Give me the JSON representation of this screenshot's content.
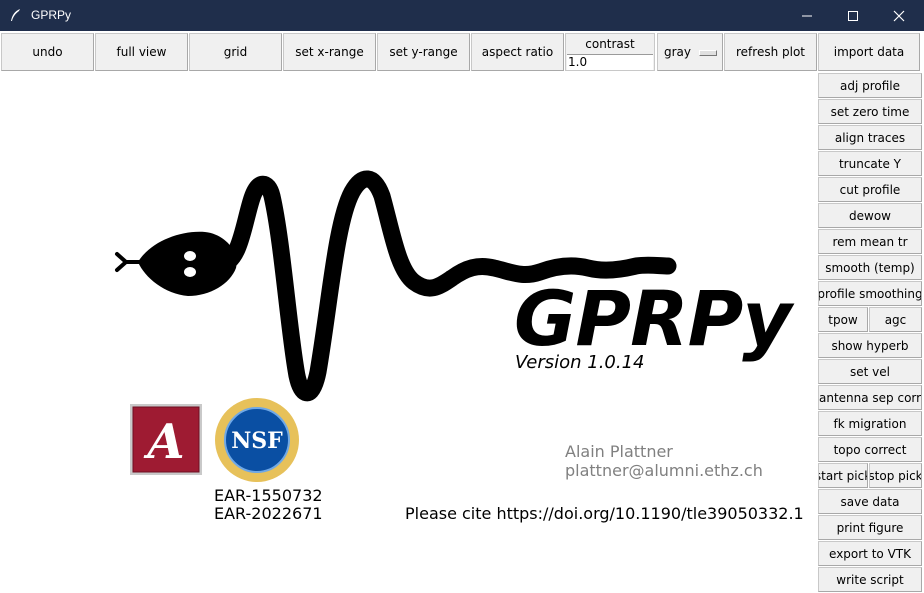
{
  "window": {
    "title": "GPRPy",
    "icon": "feather-icon",
    "controls": [
      "minimize-icon",
      "maximize-icon",
      "close-icon"
    ]
  },
  "toolbar": {
    "undo": "undo",
    "full_view": "full view",
    "grid": "grid",
    "set_x_range": "set x-range",
    "set_y_range": "set y-range",
    "aspect_ratio": "aspect ratio",
    "contrast_label": "contrast",
    "contrast_value": "1.0",
    "colormap": "gray",
    "refresh_plot": "refresh plot",
    "import_data": "import data"
  },
  "side_panel": {
    "adj_profile": "adj profile",
    "set_zero_time": "set zero time",
    "align_traces": "align traces",
    "truncate_y": "truncate Y",
    "cut_profile": "cut profile",
    "dewow": "dewow",
    "rem_mean_tr": "rem mean tr",
    "smooth_temp": "smooth (temp)",
    "profile_smoothing": "profile smoothing",
    "tpow": "tpow",
    "agc": "agc",
    "show_hyperb": "show hyperb",
    "set_vel": "set vel",
    "antenna_sep_correct": "antenna sep correct",
    "fk_migration": "fk migration",
    "topo_correct": "topo correct",
    "start_pick": "start pick",
    "stop_pick": "stop pick",
    "save_data": "save data",
    "print_figure": "print figure",
    "export_to_vtk": "export to VTK",
    "write_script": "write script"
  },
  "splash": {
    "logo_text": "GPRPy",
    "version": "Version 1.0.14",
    "author_name": "Alain Plattner",
    "author_email": "plattner@alumni.ethz.ch",
    "grant_1": "EAR-1550732",
    "grant_2": "EAR-2022671",
    "cite": "Please cite https://doi.org/10.1190/tle39050332.1",
    "ua_logo_letter": "A",
    "nsf_logo_text": "NSF"
  },
  "colors": {
    "titlebar": "#1f2e4b",
    "button_face": "#f0f0f0",
    "author_text": "#808080",
    "ua_crimson": "#9e1b32",
    "nsf_blue": "#0a4fa3",
    "nsf_gold": "#d9a520"
  }
}
